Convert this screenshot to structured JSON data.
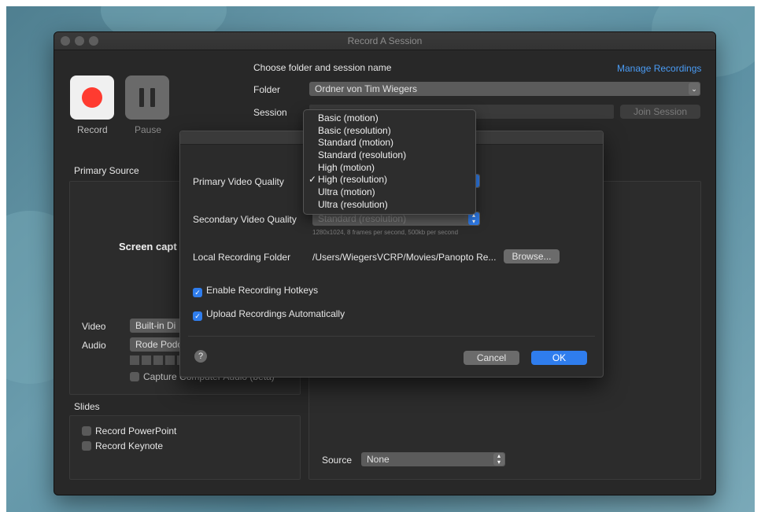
{
  "window": {
    "title": "Record A Session"
  },
  "controls": {
    "record_label": "Record",
    "pause_label": "Pause"
  },
  "session": {
    "heading": "Choose folder and session name",
    "manage_link": "Manage Recordings",
    "folder_label": "Folder",
    "folder_value": "Ordner von Tim Wiegers",
    "session_label": "Session",
    "join_button": "Join Session"
  },
  "primary": {
    "heading": "Primary Source",
    "screen_capture_text": "Screen capt",
    "video_label": "Video",
    "video_value": "Built-in Di",
    "audio_label": "Audio",
    "audio_value": "Rode Podc",
    "capture_audio_label": "Capture Computer Audio (beta)"
  },
  "slides": {
    "heading": "Slides",
    "powerpoint_label": "Record PowerPoint",
    "keynote_label": "Record Keynote"
  },
  "secondary": {
    "source_label": "Source",
    "source_value": "None"
  },
  "preferences": {
    "primary_quality_label": "Primary Video Quality",
    "secondary_quality_label": "Secondary Video Quality",
    "secondary_quality_value": "Standard (resolution)",
    "secondary_quality_hint": "1280x1024, 8 frames per second, 500kb per second",
    "local_folder_label": "Local Recording Folder",
    "local_folder_value": "/Users/WiegersVCRP/Movies/Panopto Re...",
    "browse_button": "Browse...",
    "hotkeys_label": "Enable Recording Hotkeys",
    "hotkeys_checked": true,
    "upload_label": "Upload Recordings Automatically",
    "upload_checked": true,
    "help_icon": "?",
    "cancel_button": "Cancel",
    "ok_button": "OK"
  },
  "quality_menu": {
    "options": [
      "Basic (motion)",
      "Basic (resolution)",
      "Standard (motion)",
      "Standard (resolution)",
      "High (motion)",
      "High (resolution)",
      "Ultra (motion)",
      "Ultra (resolution)"
    ],
    "selected": "High (resolution)"
  },
  "colors": {
    "accent": "#2f7ded",
    "record": "#ff3b30",
    "link": "#4a9cf5"
  }
}
